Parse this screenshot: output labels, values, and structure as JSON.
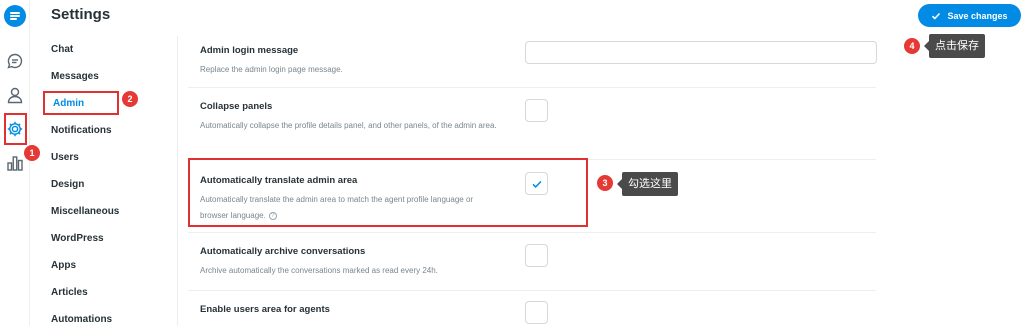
{
  "header": {
    "title": "Settings",
    "save_label": "Save changes"
  },
  "rail": {
    "icons": [
      "logo-icon",
      "chat-icon",
      "user-icon",
      "gear-icon",
      "chart-icon"
    ]
  },
  "nav": {
    "items": [
      {
        "label": "Chat"
      },
      {
        "label": "Messages"
      },
      {
        "label": "Admin",
        "active": true
      },
      {
        "label": "Notifications"
      },
      {
        "label": "Users"
      },
      {
        "label": "Design"
      },
      {
        "label": "Miscellaneous"
      },
      {
        "label": "WordPress"
      },
      {
        "label": "Apps"
      },
      {
        "label": "Articles"
      },
      {
        "label": "Automations"
      }
    ]
  },
  "settings": {
    "rows": [
      {
        "title": "Admin login message",
        "desc": "Replace the admin login page message.",
        "control": "text",
        "value": ""
      },
      {
        "title": "Collapse panels",
        "desc": "Automatically collapse the profile details panel, and other panels, of the admin area.",
        "control": "checkbox",
        "checked": false
      },
      {
        "title": "Automatically translate admin area",
        "desc": "Automatically translate the admin area to match the agent profile language or browser language.",
        "control": "checkbox",
        "checked": true,
        "help": "?"
      },
      {
        "title": "Automatically archive conversations",
        "desc": "Archive automatically the conversations marked as read every 24h.",
        "control": "checkbox",
        "checked": false
      },
      {
        "title": "Enable users area for agents",
        "desc": "",
        "control": "checkbox",
        "checked": false
      }
    ]
  },
  "annotations": {
    "badges": [
      "1",
      "2",
      "3",
      "4"
    ],
    "callout_check": "勾选这里",
    "callout_save": "点击保存"
  },
  "colors": {
    "accent": "#028be5",
    "annotation_red": "#e03030",
    "callout_bg": "#4a4a4a"
  }
}
